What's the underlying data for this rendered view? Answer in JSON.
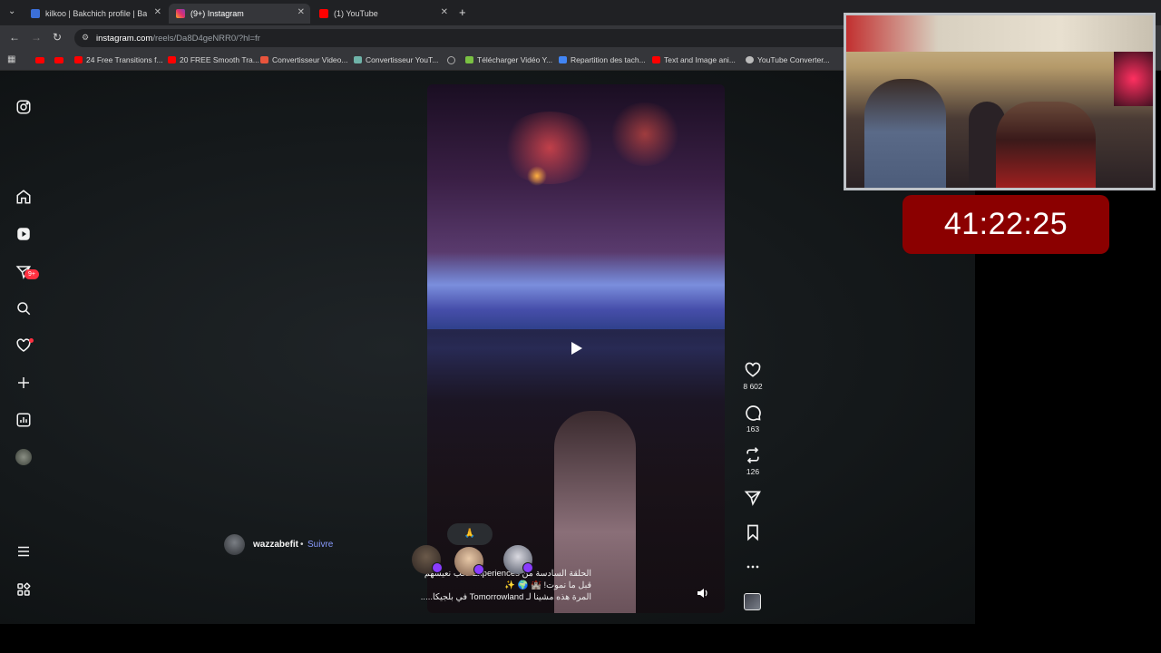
{
  "browser": {
    "tabs": [
      {
        "title": "kilkoo | Bakchich profile | Bakch",
        "icon": "bakchich-icon",
        "color": "#3b6fd8"
      },
      {
        "title": "(9+) Instagram",
        "icon": "instagram-icon",
        "color": "#e1306c"
      },
      {
        "title": "(1) YouTube",
        "icon": "youtube-icon",
        "color": "#ff0000"
      }
    ],
    "new_tab": "+",
    "url_host": "instagram.com",
    "url_path": "/reels/Da8D4geNRR0/?hl=fr",
    "bookmarks": [
      "24 Free Transitions f...",
      "20 FREE Smooth Tra...",
      "Convertisseur Video...",
      "Convertisseur YouT...",
      "Télécharger Vidéo Y...",
      "Repartition des tach...",
      "Text and Image ani...",
      "YouTube Converter..."
    ]
  },
  "sidebar": {
    "notifications_badge": "9+"
  },
  "reel": {
    "author": "wazzabefit",
    "separator": "•",
    "follow_label": "Suivre",
    "caption_lines": [
      "الحلقة السادسة من Experiences نحب نعيشهم",
      "قبل ما نموت! 🏰 🌍 ✨",
      "المرة هذه مشينا لـ Tomorrowland في بلجيكا....."
    ],
    "reaction_emoji": "🙏",
    "likes": "8 602",
    "comments": "163",
    "reposts": "126"
  },
  "stream": {
    "timer": "41:22:25"
  },
  "colors": {
    "accent_follow": "#8a9cff",
    "badge_red": "#ff3040",
    "timer_bg": "#8b0000"
  }
}
